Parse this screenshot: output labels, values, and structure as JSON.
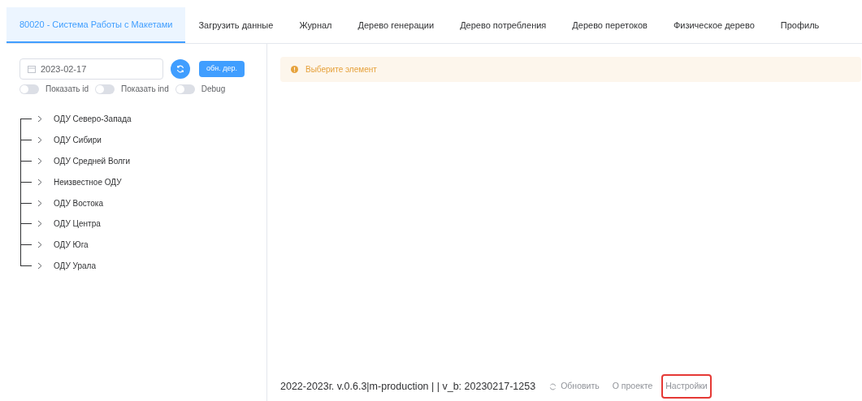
{
  "tabs": [
    {
      "label": "80020 - Система Работы с Макетами",
      "selected": true
    },
    {
      "label": "Загрузить данные",
      "selected": false
    },
    {
      "label": "Журнал",
      "selected": false
    },
    {
      "label": "Дерево генерации",
      "selected": false
    },
    {
      "label": "Дерево потребления",
      "selected": false
    },
    {
      "label": "Дерево перетоков",
      "selected": false
    },
    {
      "label": "Физическое дерево",
      "selected": false
    },
    {
      "label": "Профиль",
      "selected": false
    }
  ],
  "sidebar": {
    "date": "2023-02-17",
    "refresh_tree_button": "обн. дер.",
    "toggles": [
      {
        "label": "Показать id",
        "on": false
      },
      {
        "label": "Показать ind",
        "on": false
      },
      {
        "label": "Debug",
        "on": false
      }
    ],
    "tree": [
      {
        "label": "ОДУ Северо-Запада",
        "expanded": false
      },
      {
        "label": "ОДУ Сибири",
        "expanded": false
      },
      {
        "label": "ОДУ Средней Волги",
        "expanded": false
      },
      {
        "label": "Неизвестное ОДУ",
        "expanded": false
      },
      {
        "label": "ОДУ Востока",
        "expanded": false
      },
      {
        "label": "ОДУ Центра",
        "expanded": false
      },
      {
        "label": "ОДУ Юга",
        "expanded": false
      },
      {
        "label": "ОДУ Урала",
        "expanded": false
      }
    ]
  },
  "alert": {
    "text": "Выберите элемент"
  },
  "footer": {
    "version": "2022-2023г. v.0.6.3|m-production | | v_b: 20230217-1253",
    "links": [
      {
        "label": "Обновить",
        "kind": "refresh",
        "highlighted": false
      },
      {
        "label": "О проекте",
        "kind": "plain",
        "highlighted": false
      },
      {
        "label": "Настройки",
        "kind": "plain",
        "highlighted": true
      }
    ]
  }
}
